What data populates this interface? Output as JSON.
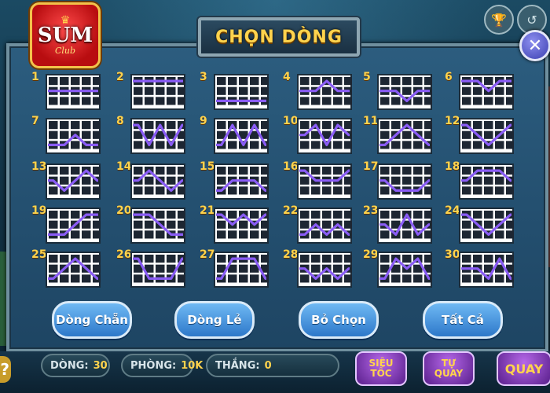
{
  "logo": {
    "brand": "SUM",
    "sub": "Club"
  },
  "title": "CHỌN DÒNG",
  "buttons": {
    "even": "Dòng Chẵn",
    "odd": "Dòng Lẻ",
    "deselect": "Bỏ Chọn",
    "all": "Tất Cả"
  },
  "bottom": {
    "dong_label": "DÒNG:",
    "dong_value": "30",
    "phong_label": "PHÒNG:",
    "phong_value": "10K",
    "thang_label": "THẮNG:",
    "thang_value": "0",
    "help": "?",
    "sieu_toc": [
      "SIÊU",
      "TỐC"
    ],
    "tu_quay": [
      "TỰ",
      "QUAY"
    ],
    "quay": "QUAY"
  },
  "icons": {
    "close": "close-icon",
    "trophy": "trophy-icon",
    "history": "history-icon"
  },
  "colors": {
    "line": "#8a5cf5",
    "title": "#ffd34d",
    "number": "#ffd34d",
    "panel": "#2c5d7f"
  },
  "paylines": [
    {
      "num": "1",
      "rows": [
        1,
        1,
        1,
        1,
        1
      ]
    },
    {
      "num": "2",
      "rows": [
        0,
        0,
        0,
        0,
        0
      ]
    },
    {
      "num": "3",
      "rows": [
        2,
        2,
        2,
        2,
        2
      ]
    },
    {
      "num": "4",
      "rows": [
        1,
        1,
        0,
        1,
        1
      ]
    },
    {
      "num": "5",
      "rows": [
        1,
        1,
        2,
        1,
        1
      ]
    },
    {
      "num": "6",
      "rows": [
        0,
        0,
        1,
        0,
        0
      ]
    },
    {
      "num": "7",
      "rows": [
        2,
        2,
        1,
        2,
        2
      ]
    },
    {
      "num": "8",
      "rows": [
        0,
        2,
        0,
        2,
        0
      ]
    },
    {
      "num": "9",
      "rows": [
        2,
        0,
        2,
        0,
        2
      ]
    },
    {
      "num": "10",
      "rows": [
        1,
        0,
        2,
        0,
        1
      ]
    },
    {
      "num": "11",
      "rows": [
        2,
        1,
        0,
        1,
        2
      ]
    },
    {
      "num": "12",
      "rows": [
        0,
        1,
        2,
        1,
        0
      ]
    },
    {
      "num": "13",
      "rows": [
        1,
        2,
        1,
        0,
        1
      ]
    },
    {
      "num": "14",
      "rows": [
        1,
        0,
        1,
        2,
        1
      ]
    },
    {
      "num": "15",
      "rows": [
        2,
        1,
        1,
        1,
        2
      ]
    },
    {
      "num": "16",
      "rows": [
        0,
        1,
        1,
        1,
        0
      ]
    },
    {
      "num": "17",
      "rows": [
        1,
        2,
        2,
        2,
        1
      ]
    },
    {
      "num": "18",
      "rows": [
        1,
        0,
        0,
        0,
        1
      ]
    },
    {
      "num": "19",
      "rows": [
        2,
        2,
        1,
        0,
        0
      ]
    },
    {
      "num": "20",
      "rows": [
        0,
        0,
        1,
        2,
        2
      ]
    },
    {
      "num": "21",
      "rows": [
        0,
        1,
        0,
        1,
        0
      ]
    },
    {
      "num": "22",
      "rows": [
        2,
        1,
        2,
        1,
        2
      ]
    },
    {
      "num": "23",
      "rows": [
        1,
        2,
        0,
        2,
        1
      ]
    },
    {
      "num": "24",
      "rows": [
        0,
        1,
        2,
        1,
        0
      ]
    },
    {
      "num": "25",
      "rows": [
        2,
        1,
        0,
        1,
        2
      ]
    },
    {
      "num": "26",
      "rows": [
        0,
        2,
        2,
        2,
        0
      ]
    },
    {
      "num": "27",
      "rows": [
        2,
        0,
        0,
        0,
        2
      ]
    },
    {
      "num": "28",
      "rows": [
        1,
        2,
        1,
        2,
        1
      ]
    },
    {
      "num": "29",
      "rows": [
        2,
        0,
        1,
        0,
        2
      ]
    },
    {
      "num": "30",
      "rows": [
        1,
        1,
        2,
        0,
        2
      ]
    }
  ]
}
